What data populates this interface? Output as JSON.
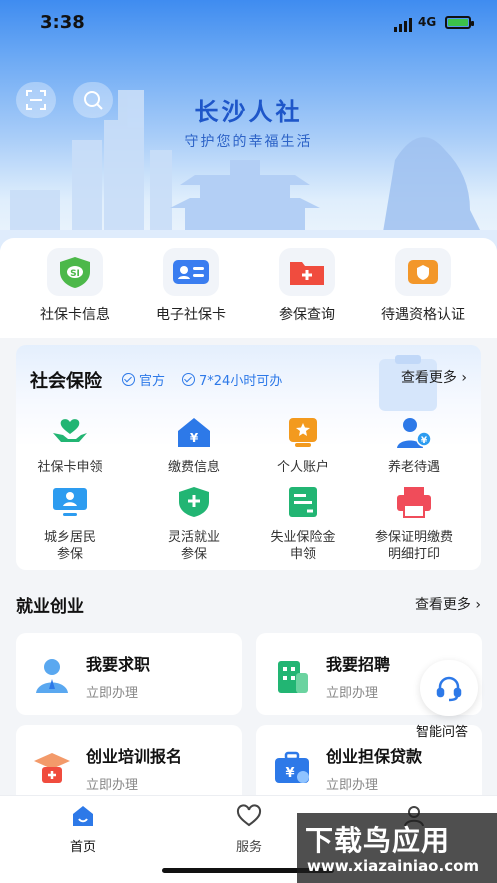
{
  "status_bar": {
    "time": "3:38",
    "network": "4G"
  },
  "header": {
    "title": "长沙人社",
    "subtitle": "守护您的幸福生活"
  },
  "quick_services": [
    {
      "label": "社保卡信息",
      "icon": "shield-card-icon",
      "color": "#4cb84a"
    },
    {
      "label": "电子社保卡",
      "icon": "id-card-icon",
      "color": "#3a7df0"
    },
    {
      "label": "参保查询",
      "icon": "medical-folder-icon",
      "color": "#f04c3e"
    },
    {
      "label": "待遇资格认证",
      "icon": "certificate-icon",
      "color": "#f3972a"
    }
  ],
  "social_insurance": {
    "title": "社会保险",
    "tags": [
      "官方",
      "7*24小时可办"
    ],
    "more": "查看更多",
    "items": [
      {
        "label": "社保卡申领",
        "icon": "hands-heart-icon",
        "color": "#22b573"
      },
      {
        "label": "缴费信息",
        "icon": "yuan-house-icon",
        "color": "#2d79e8"
      },
      {
        "label": "个人账户",
        "icon": "star-badge-icon",
        "color": "#f39a1e"
      },
      {
        "label": "养老待遇",
        "icon": "elderly-yuan-icon",
        "color": "#2d79e8"
      },
      {
        "label": "城乡居民\n参保",
        "icon": "resident-monitor-icon",
        "color": "#2d9cf0"
      },
      {
        "label": "灵活就业\n参保",
        "icon": "shield-plus-icon",
        "color": "#22b573"
      },
      {
        "label": "失业保险金\n申领",
        "icon": "document-form-icon",
        "color": "#22b573"
      },
      {
        "label": "参保证明缴费\n明细打印",
        "icon": "printer-icon",
        "color": "#f04c5a"
      }
    ]
  },
  "employment": {
    "title": "就业创业",
    "more": "查看更多",
    "cards": [
      {
        "title": "我要求职",
        "sub": "立即办理",
        "icon": "job-seeker-icon"
      },
      {
        "title": "我要招聘",
        "sub": "立即办理",
        "icon": "building-icon"
      },
      {
        "title": "创业培训报名",
        "sub": "立即办理",
        "icon": "grad-cap-icon"
      },
      {
        "title": "创业担保贷款",
        "sub": "立即办理",
        "icon": "briefcase-yuan-icon"
      }
    ]
  },
  "assistant": {
    "label": "智能问答"
  },
  "tabs": [
    {
      "label": "首页",
      "active": true
    },
    {
      "label": "服务",
      "active": false
    }
  ],
  "watermark": {
    "line1": "下载鸟应用",
    "line2": "www.xiazainiao.com"
  }
}
